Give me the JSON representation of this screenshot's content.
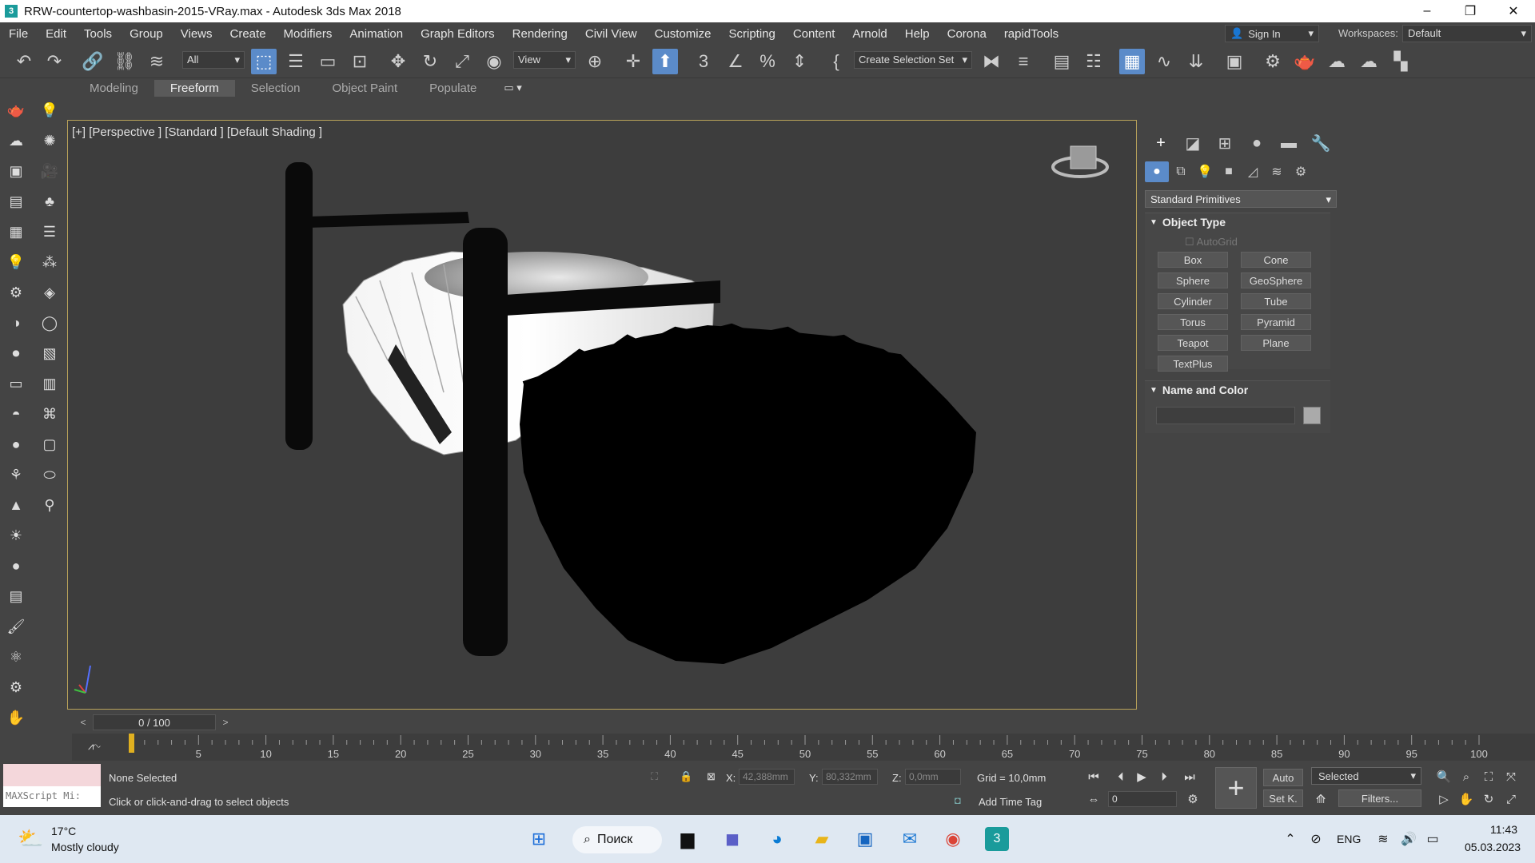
{
  "window": {
    "title": "RRW-countertop-washbasin-2015-VRay.max - Autodesk 3ds Max 2018",
    "app_icon": "3",
    "minimize": "–",
    "restore": "❐",
    "close": "✕"
  },
  "menu": [
    "File",
    "Edit",
    "Tools",
    "Group",
    "Views",
    "Create",
    "Modifiers",
    "Animation",
    "Graph Editors",
    "Rendering",
    "Civil View",
    "Customize",
    "Scripting",
    "Content",
    "Arnold",
    "Help",
    "Corona",
    "rapidTools"
  ],
  "account": {
    "signin": "Sign In",
    "workspaces_label": "Workspaces:",
    "workspace_value": "Default"
  },
  "toolbar": {
    "filter_value": "All",
    "refcoord_value": "View",
    "selection_set": "Create Selection Set"
  },
  "ribbon": {
    "tabs": [
      "Modeling",
      "Freeform",
      "Selection",
      "Object Paint",
      "Populate"
    ],
    "active": "Freeform"
  },
  "viewport": {
    "label": "[+] [Perspective ] [Standard ] [Default Shading ]",
    "border_color": "#b8a25a"
  },
  "command_panel": {
    "category": "Standard Primitives",
    "object_type_title": "Object Type",
    "autogrid": "AutoGrid",
    "buttons": [
      "Box",
      "Cone",
      "Sphere",
      "GeoSphere",
      "Cylinder",
      "Tube",
      "Torus",
      "Pyramid",
      "Teapot",
      "Plane",
      "TextPlus"
    ],
    "name_color_title": "Name and Color"
  },
  "timeline": {
    "frame": "0 / 100",
    "prev": "<",
    "next": ">",
    "ticks": [
      "5",
      "10",
      "15",
      "20",
      "25",
      "30",
      "35",
      "40",
      "45",
      "50",
      "55",
      "60",
      "65",
      "70",
      "75",
      "80",
      "85",
      "90",
      "95",
      "100"
    ]
  },
  "status": {
    "maxscript": "MAXScript Mi:",
    "selection": "None Selected",
    "prompt": "Click or click-and-drag to select objects",
    "x_label": "X:",
    "x_value": "42,388mm",
    "y_label": "Y:",
    "y_value": "80,332mm",
    "z_label": "Z:",
    "z_value": "0,0mm",
    "grid": "Grid = 10,0mm",
    "add_time_tag": "Add Time Tag",
    "auto": "Auto",
    "setk": "Set K.",
    "key_filter": "Selected",
    "filters": "Filters...",
    "frame_field": "0"
  },
  "taskbar": {
    "temp": "17°C",
    "weather": "Mostly cloudy",
    "search": "Поиск",
    "lang": "ENG",
    "time": "11:43",
    "date": "05.03.2023"
  }
}
